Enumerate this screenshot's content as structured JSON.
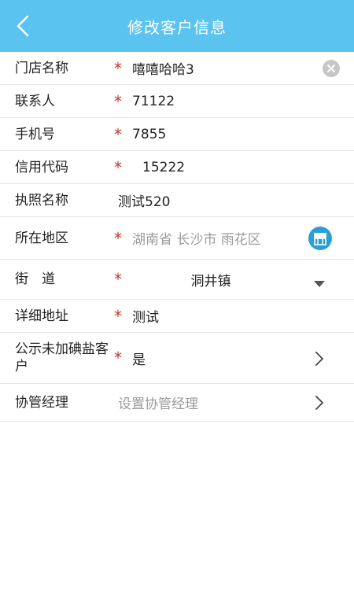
{
  "header": {
    "title": "修改客户信息"
  },
  "rows": {
    "store_name": {
      "label": "门店名称",
      "value": "嘻嘻哈哈3"
    },
    "contact": {
      "label": "联系人",
      "value": "71122"
    },
    "phone": {
      "label": "手机号",
      "value": "7855"
    },
    "credit_code": {
      "label": "信用代码",
      "value": "15222"
    },
    "license_name": {
      "label": "执照名称",
      "value": "测试520"
    },
    "region": {
      "label": "所在地区",
      "value": "湖南省 长沙市 雨花区"
    },
    "street": {
      "label": "街　道",
      "value": "洞井镇"
    },
    "address": {
      "label": "详细地址",
      "value": "测试"
    },
    "publicity": {
      "label": "公示未加碘盐客户",
      "value": "是"
    },
    "manager": {
      "label": "协管经理",
      "placeholder": "设置协管经理"
    }
  },
  "required_mark": "*",
  "colors": {
    "header_bg": "#5bc3f0",
    "required": "#c0392b",
    "store_icon_bg": "#2a9fd6"
  }
}
